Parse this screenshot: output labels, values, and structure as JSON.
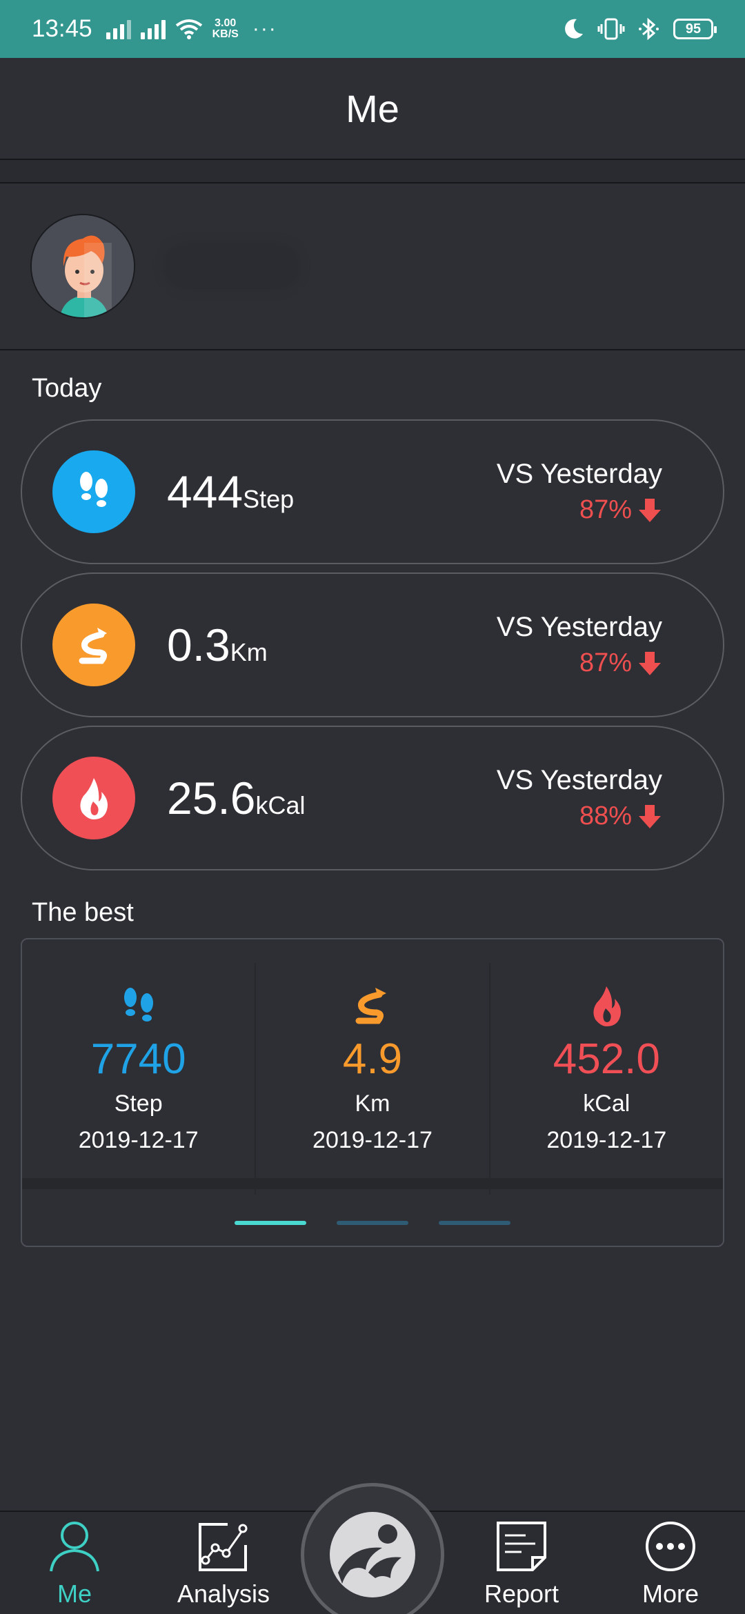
{
  "status_bar": {
    "time": "13:45",
    "network_speed_value": "3.00",
    "network_speed_unit": "KB/S",
    "more": "···",
    "battery": "95"
  },
  "header": {
    "title": "Me"
  },
  "today": {
    "label": "Today",
    "cards": [
      {
        "icon": "footprints-icon",
        "color": "#18a9ee",
        "value": "444",
        "unit": "Step",
        "compare_label": "VS Yesterday",
        "percent": "87%",
        "trend": "down"
      },
      {
        "icon": "route-icon",
        "color": "#f99a2c",
        "value": "0.3",
        "unit": "Km",
        "compare_label": "VS Yesterday",
        "percent": "87%",
        "trend": "down"
      },
      {
        "icon": "flame-icon",
        "color": "#ef4f55",
        "value": "25.6",
        "unit": "kCal",
        "compare_label": "VS Yesterday",
        "percent": "88%",
        "trend": "down"
      }
    ]
  },
  "best": {
    "label": "The best",
    "items": [
      {
        "icon": "footprints-icon",
        "color": "#1fa3e6",
        "value": "7740",
        "unit": "Step",
        "date": "2019-12-17"
      },
      {
        "icon": "route-icon",
        "color": "#f99a2c",
        "value": "4.9",
        "unit": "Km",
        "date": "2019-12-17"
      },
      {
        "icon": "flame-icon",
        "color": "#ef4f55",
        "value": "452.0",
        "unit": "kCal",
        "date": "2019-12-17"
      }
    ],
    "pager": {
      "pages": 3,
      "active": 1
    }
  },
  "bottom_nav": {
    "items": [
      {
        "label": "Me",
        "icon": "person-icon",
        "active": true
      },
      {
        "label": "Analysis",
        "icon": "analysis-chart-icon",
        "active": false
      },
      {
        "label": "Report",
        "icon": "report-icon",
        "active": false
      },
      {
        "label": "More",
        "icon": "more-dots-icon",
        "active": false
      }
    ],
    "center_button_icon": "runner-logo-icon"
  },
  "colors": {
    "accent": "#3ed0c4",
    "status_bar": "#33968f",
    "down_trend": "#ef4f4f"
  }
}
